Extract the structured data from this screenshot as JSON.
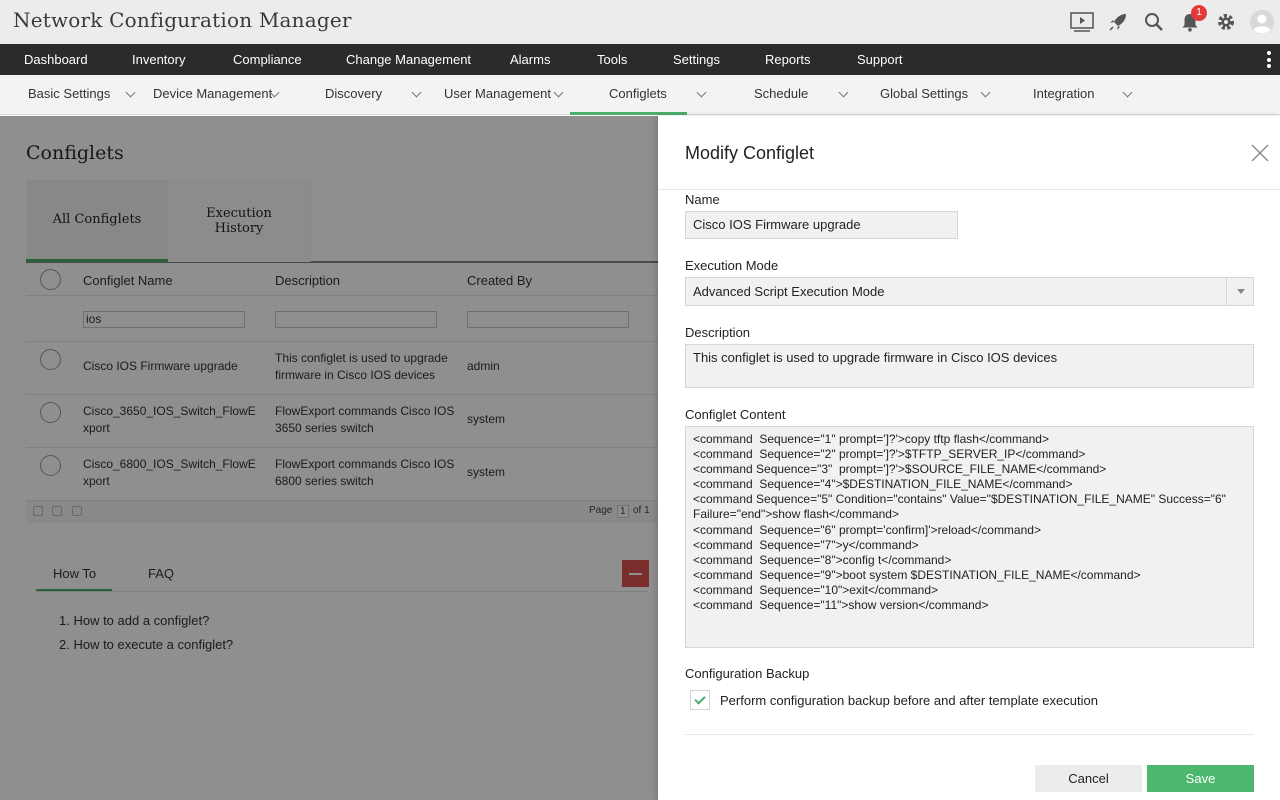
{
  "app": {
    "title": "Network Configuration Manager",
    "notification_count": "1",
    "accent_color": "#4cae6d",
    "icons": [
      "tv-icon",
      "rocket-icon",
      "search-icon",
      "bell-icon",
      "gear-icon",
      "user-avatar-icon"
    ]
  },
  "main_nav": [
    "Dashboard",
    "Inventory",
    "Compliance",
    "Change Management",
    "Alarms",
    "Tools",
    "Settings",
    "Reports",
    "Support"
  ],
  "sub_nav": {
    "items": [
      "Basic Settings",
      "Device Management",
      "Discovery",
      "User Management",
      "Configlets",
      "Schedule",
      "Global Settings",
      "Integration"
    ],
    "active": "Configlets"
  },
  "page": {
    "title": "Configlets",
    "tabs": [
      "All Configlets",
      "Execution History"
    ],
    "active_tab": "All Configlets"
  },
  "grid": {
    "columns": [
      "Configlet Name",
      "Description",
      "Created By"
    ],
    "filters": [
      "ios",
      "",
      ""
    ],
    "rows": [
      {
        "name": "Cisco IOS Firmware upgrade",
        "description": "This configlet is used to upgrade firmware in Cisco IOS devices",
        "created_by": "admin"
      },
      {
        "name": "Cisco_3650_IOS_Switch_FlowExport",
        "description": "FlowExport commands Cisco IOS 3650 series switch",
        "created_by": "system"
      },
      {
        "name": "Cisco_6800_IOS_Switch_FlowExport",
        "description": "FlowExport commands Cisco IOS 6800 series switch",
        "created_by": "system"
      }
    ],
    "pager": {
      "page_label": "Page",
      "page_value": "1",
      "of_label": "of 1"
    }
  },
  "help": {
    "tabs": [
      "How To",
      "FAQ"
    ],
    "active_tab": "How To",
    "items": [
      "1. How to add a configlet?",
      "2. How to execute a configlet?"
    ]
  },
  "modal": {
    "title": "Modify Configlet",
    "name_label": "Name",
    "name_value": "Cisco IOS Firmware upgrade",
    "mode_label": "Execution Mode",
    "mode_value": "Advanced Script Execution Mode",
    "description_label": "Description",
    "description_value": "This configlet is used to upgrade firmware in Cisco IOS devices",
    "content_label": "Configlet Content",
    "content_lines": [
      "<command  Sequence=\"1\" prompt=']?'>copy tftp flash</command>",
      "<command  Sequence=\"2\" prompt=']?'>$TFTP_SERVER_IP</command>",
      "<command Sequence=\"3\"  prompt=']?'>$SOURCE_FILE_NAME</command>",
      "<command  Sequence=\"4\">$DESTINATION_FILE_NAME</command>",
      "<command Sequence=\"5\" Condition=\"contains\" Value=\"$DESTINATION_FILE_NAME\" Success=\"6\" Failure=\"end\">show flash</command>",
      "<command  Sequence=\"6\" prompt='confirm]'>reload</command>",
      "<command  Sequence=\"7\">y</command>",
      "<command  Sequence=\"8\">config t</command>",
      "<command  Sequence=\"9\">boot system $DESTINATION_FILE_NAME</command>",
      "<command  Sequence=\"10\">exit</command>",
      "<command  Sequence=\"11\">show version</command>"
    ],
    "backup_label": "Configuration Backup",
    "backup_checked": true,
    "backup_text": "Perform configuration backup before and after template execution",
    "cancel_label": "Cancel",
    "save_label": "Save",
    "save_color": "#4cb86e"
  }
}
